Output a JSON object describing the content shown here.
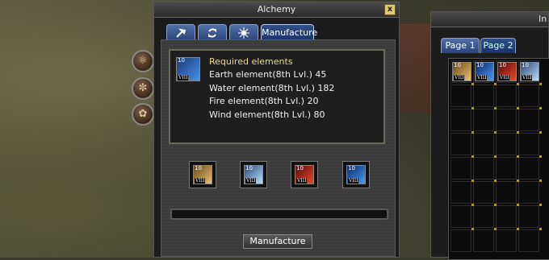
{
  "window": {
    "title": "Alchemy",
    "close_label": "x"
  },
  "tabs": [
    {
      "icon": "hammer-icon"
    },
    {
      "icon": "recycle-icon"
    },
    {
      "icon": "sparkle-icon"
    },
    {
      "label": "Manufacture",
      "active": true
    }
  ],
  "side_buttons": [
    {
      "icon": "potion-orb-icon"
    },
    {
      "icon": "swirl-orb-icon"
    },
    {
      "icon": "spiral-orb-icon"
    }
  ],
  "recipe": {
    "item": {
      "icon": "water-element-icon",
      "level": "10",
      "tier": "VIII"
    },
    "heading": "Required elements",
    "lines": [
      "Earth element(8th Lvl.) 45",
      "Water element(8th Lvl.) 182",
      "Fire element(8th Lvl.) 20",
      "Wind element(8th Lvl.) 80"
    ]
  },
  "slots": [
    {
      "icon": "earth-element-icon",
      "level": "10",
      "tier": "VIII",
      "color": "#c89a40"
    },
    {
      "icon": "wind-element-icon",
      "level": "10",
      "tier": "VIII",
      "color": "#7ab0e8"
    },
    {
      "icon": "fire-element-icon",
      "level": "10",
      "tier": "VIII",
      "color": "#d83a2a"
    },
    {
      "icon": "water-element-icon",
      "level": "10",
      "tier": "VIII",
      "color": "#3a78d8"
    }
  ],
  "manufacture_button": "Manufacture",
  "inventory": {
    "title": "In",
    "tabs": [
      {
        "label": "Page 1"
      },
      {
        "label": "Page 2",
        "active": true
      }
    ],
    "items": [
      {
        "icon": "earth-element-icon",
        "level": "10",
        "tier": "VIII",
        "color": "#c89a40"
      },
      {
        "icon": "water-element-icon",
        "level": "10",
        "tier": "VIII",
        "color": "#3a78d8"
      },
      {
        "icon": "fire-element-icon",
        "level": "10",
        "tier": "VIII",
        "color": "#d83a2a"
      },
      {
        "icon": "wind-element-icon",
        "level": "10",
        "tier": "VIII",
        "color": "#7ab0e8"
      }
    ]
  }
}
